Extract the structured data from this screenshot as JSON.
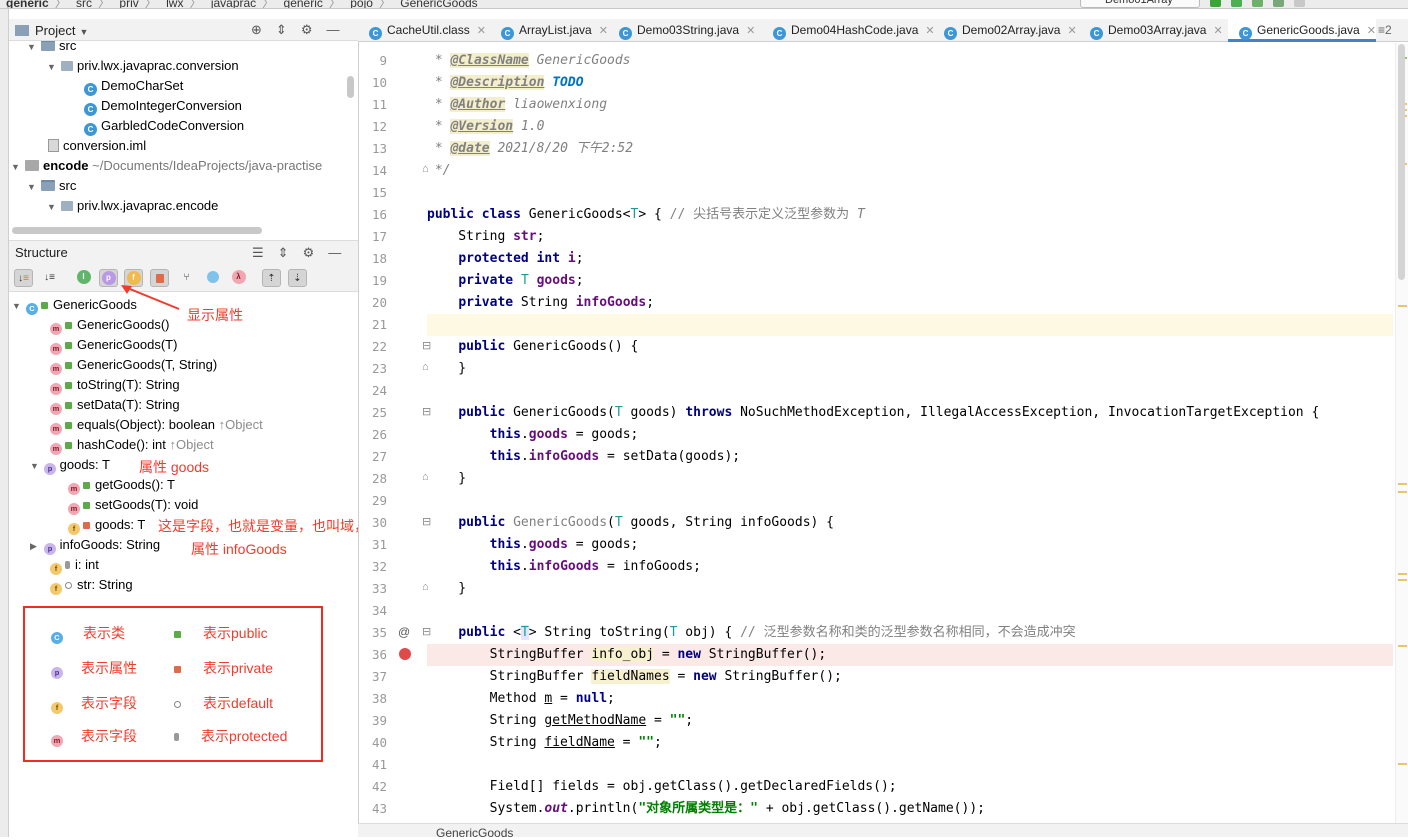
{
  "breadcrumbs": [
    "generic",
    "src",
    "priv",
    "lwx",
    "javaprac",
    "generic",
    "pojo",
    "GenericGoods"
  ],
  "run_config": "Demo01Array",
  "project_panel": {
    "title": "Project",
    "tree": [
      {
        "label": "src",
        "type": "folder"
      },
      {
        "label": "priv.lwx.javaprac.conversion",
        "type": "package"
      },
      {
        "label": "DemoCharSet",
        "type": "class"
      },
      {
        "label": "DemoIntegerConversion",
        "type": "class"
      },
      {
        "label": "GarbledCodeConversion",
        "type": "class"
      },
      {
        "label": "conversion.iml",
        "type": "file"
      },
      {
        "label": "encode",
        "path": "~/Documents/IdeaProjects/java-practise",
        "type": "module"
      },
      {
        "label": "src",
        "type": "folder"
      },
      {
        "label": "priv.lwx.javaprac.encode",
        "type": "package"
      }
    ]
  },
  "structure_panel": {
    "title": "Structure",
    "tree": [
      {
        "label": "GenericGoods",
        "icon": "c",
        "access": "public"
      },
      {
        "label": "GenericGoods()",
        "icon": "m",
        "access": "public"
      },
      {
        "label": "GenericGoods(T)",
        "icon": "m",
        "access": "public"
      },
      {
        "label": "GenericGoods(T, String)",
        "icon": "m",
        "access": "public"
      },
      {
        "label": "toString(T): String",
        "icon": "m",
        "access": "public"
      },
      {
        "label": "setData(T): String",
        "icon": "m",
        "access": "public"
      },
      {
        "label": "equals(Object): boolean",
        "hint": "↑Object",
        "icon": "m",
        "access": "public"
      },
      {
        "label": "hashCode(): int",
        "hint": "↑Object",
        "icon": "m",
        "access": "public"
      },
      {
        "label": "goods: T",
        "icon": "p",
        "access": ""
      },
      {
        "label": "getGoods(): T",
        "icon": "m",
        "access": "public"
      },
      {
        "label": "setGoods(T): void",
        "icon": "m",
        "access": "public"
      },
      {
        "label": "goods: T",
        "icon": "f",
        "access": "private"
      },
      {
        "label": "infoGoods: String",
        "icon": "p",
        "access": ""
      },
      {
        "label": "i: int",
        "icon": "f",
        "access": "protected"
      },
      {
        "label": "str: String",
        "icon": "f",
        "access": "default"
      }
    ]
  },
  "annotations": {
    "show_property": "显示属性",
    "property_goods": "属性 goods",
    "field_note": "这是字段，也就是变量，也叫域，名称 goods",
    "property_infogoods": "属性 infoGoods"
  },
  "legend": {
    "class": "表示类",
    "property": "表示属性",
    "field_f": "表示字段",
    "field_m": "表示字段",
    "public": "表示public",
    "private": "表示private",
    "default": "表示default",
    "protected": "表示protected"
  },
  "editor_tabs": [
    {
      "label": "CacheUtil.class",
      "active": false
    },
    {
      "label": "ArrayList.java",
      "active": false
    },
    {
      "label": "Demo03String.java",
      "active": false
    },
    {
      "label": "Demo04HashCode.java",
      "active": false
    },
    {
      "label": "Demo02Array.java",
      "active": false
    },
    {
      "label": "Demo03Array.java",
      "active": false
    },
    {
      "label": "GenericGoods.java",
      "active": true
    }
  ],
  "tab_overflow": "≡2",
  "code": {
    "line_numbers": [
      "9",
      "10",
      "11",
      "12",
      "13",
      "14",
      "15",
      "16",
      "17",
      "18",
      "19",
      "20",
      "21",
      "22",
      "23",
      "24",
      "25",
      "26",
      "27",
      "28",
      "29",
      "30",
      "31",
      "32",
      "33",
      "34",
      "35",
      "36",
      "37",
      "38",
      "39",
      "40",
      "41",
      "42",
      "43"
    ],
    "doc_tags": {
      "classname_tag": "@ClassName",
      "classname_val": "GenericGoods",
      "desc_tag": "@Description",
      "desc_val": "TODO",
      "author_tag": "@Author",
      "author_val": "liaowenxiong",
      "version_tag": "@Version",
      "version_val": "1.0",
      "date_tag": "@date",
      "date_val": "2021/8/20 下午2:52"
    },
    "class_comment": "// 尖括号表示定义泛型参数为",
    "tostring_comment": "// 泛型参数名称和类的泛型参数名称相同，不会造成冲突",
    "string_literal": "\"对象所属类型是：\"",
    "empty_string": "\"\""
  },
  "status_bar": {
    "path": "GenericGoods"
  },
  "colors": {
    "accent": "#4083c9",
    "annotation_red": "#f03c2c",
    "keyword": "#000080",
    "field": "#660e7a"
  }
}
